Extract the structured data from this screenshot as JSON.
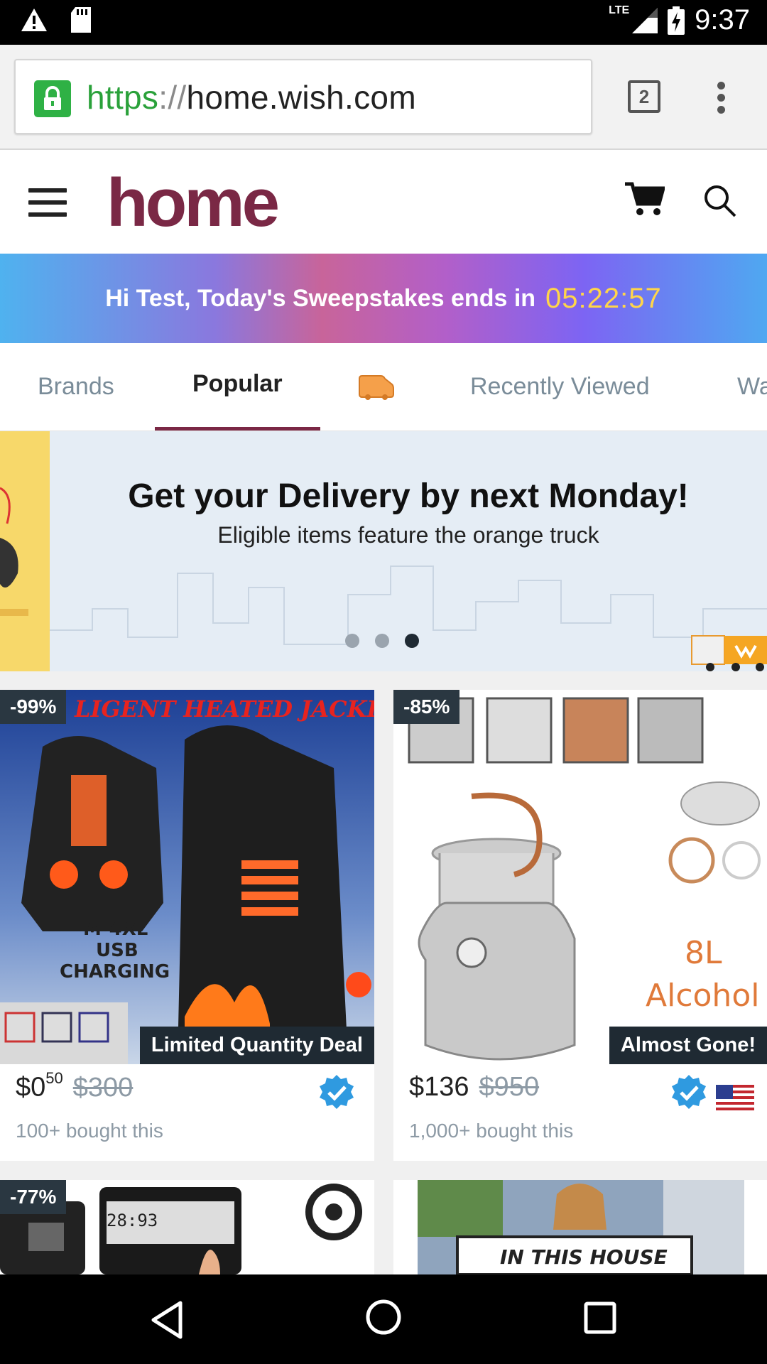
{
  "status_bar": {
    "time": "9:37",
    "network": "LTE"
  },
  "browser": {
    "url_protocol": "https",
    "url_separator": "://",
    "url_host": "home.wish.com",
    "tab_count": "2"
  },
  "app": {
    "logo_text": "home"
  },
  "sweepstakes": {
    "message": "Hi Test, Today's Sweepstakes ends in",
    "timer": "05:22:57"
  },
  "tabs": [
    {
      "label": "Brands"
    },
    {
      "label": "Popular"
    },
    {
      "label": "Recently Viewed"
    },
    {
      "label": "Wa"
    }
  ],
  "banner": {
    "title": "Get your Delivery by next Monday!",
    "subtitle": "Eligible items feature the orange truck",
    "active_slide": 3,
    "slide_count": 3
  },
  "products": [
    {
      "discount": "-99%",
      "image_caption": "LIGENT HEATED JACKET",
      "image_text_1": "M-4XL",
      "image_text_2": "USB",
      "image_text_3": "CHARGING",
      "tag": "Limited Quantity Deal",
      "price_main": "$0",
      "price_cents": "50",
      "old_price": "$300",
      "bought": "100+ bought this"
    },
    {
      "discount": "-85%",
      "image_text_1": "8L",
      "image_text_2": "Alcohol",
      "tag": "Almost Gone!",
      "price_main": "$136",
      "old_price": "$950",
      "bought": "1,000+ bought this"
    },
    {
      "discount": "-77%",
      "image_text_1": "28:93"
    },
    {
      "image_text_1": "IN THIS HOUSE"
    }
  ],
  "colors": {
    "brand": "#7a2845",
    "timer": "#ffd54a",
    "secure_green": "#2fb145"
  }
}
